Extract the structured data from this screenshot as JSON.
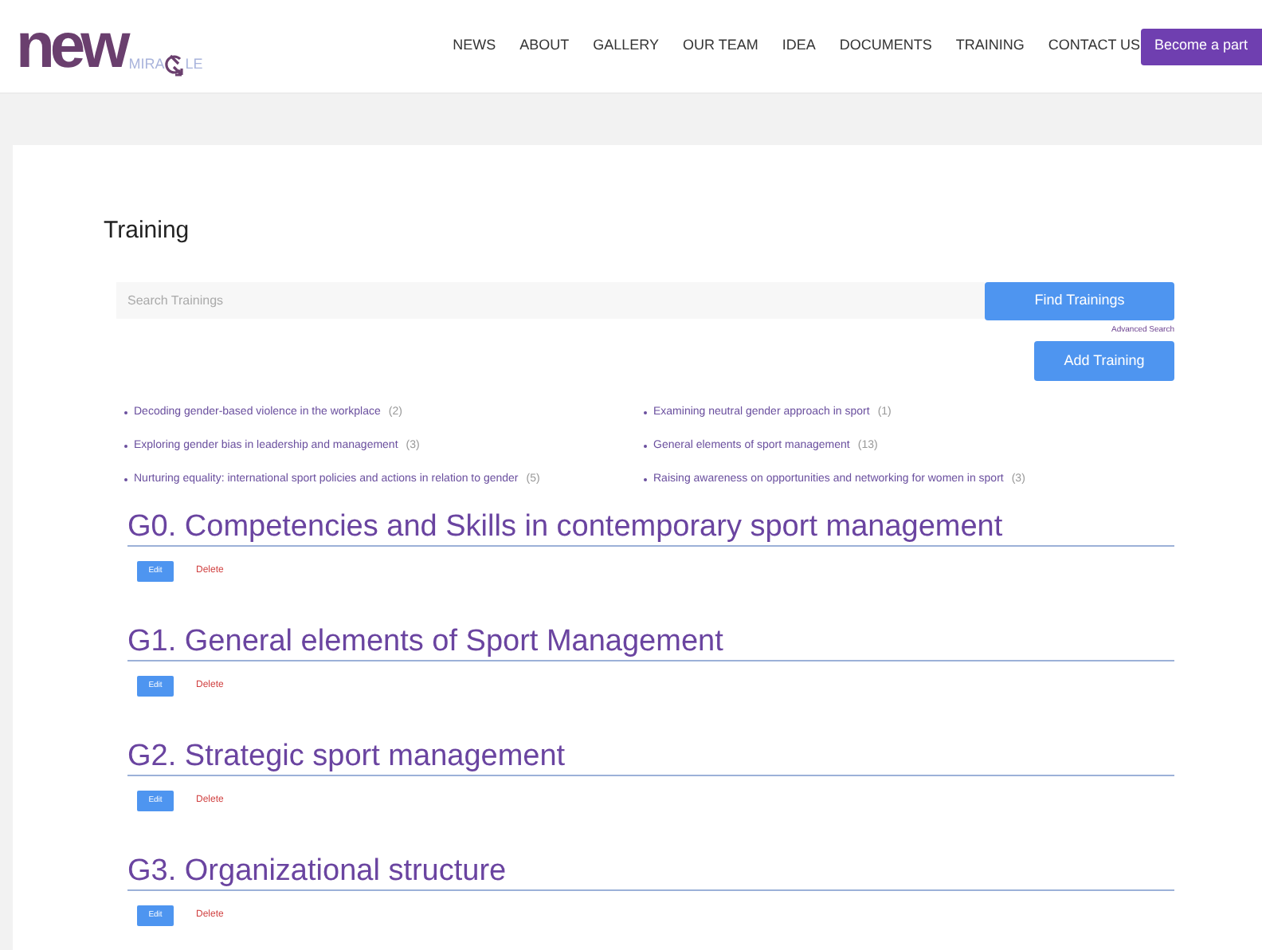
{
  "logo": {
    "word": "new",
    "sub_left": "MIRA",
    "sub_right": "LE"
  },
  "nav": {
    "items": [
      "NEWS",
      "ABOUT",
      "GALLERY",
      "OUR TEAM",
      "IDEA",
      "DOCUMENTS",
      "TRAINING",
      "CONTACT US"
    ],
    "cta": "Become a part"
  },
  "page": {
    "title": "Training",
    "search": {
      "placeholder": "Search Trainings",
      "button": "Find Trainings",
      "advanced": "Advanced Search"
    },
    "add_button": "Add Training",
    "categories": [
      {
        "label": "Decoding gender-based violence in the workplace",
        "count": "(2)"
      },
      {
        "label": "Examining neutral gender approach in sport",
        "count": "(1)"
      },
      {
        "label": "Exploring gender bias in leadership and management",
        "count": "(3)"
      },
      {
        "label": "General elements of sport management",
        "count": "(13)"
      },
      {
        "label": "Nurturing equality: international sport policies and actions in relation to gender",
        "count": "(5)"
      },
      {
        "label": "Raising awareness on opportunities and networking for women in sport",
        "count": "(3)"
      }
    ],
    "trainings": [
      {
        "title": "G0. Competencies and Skills in contemporary sport management",
        "edit": "Edit",
        "delete": "Delete"
      },
      {
        "title": "G1. General elements of Sport Management",
        "edit": "Edit",
        "delete": "Delete"
      },
      {
        "title": "G2. Strategic sport management",
        "edit": "Edit",
        "delete": "Delete"
      },
      {
        "title": "G3. Organizational structure",
        "edit": "Edit",
        "delete": "Delete"
      }
    ]
  }
}
